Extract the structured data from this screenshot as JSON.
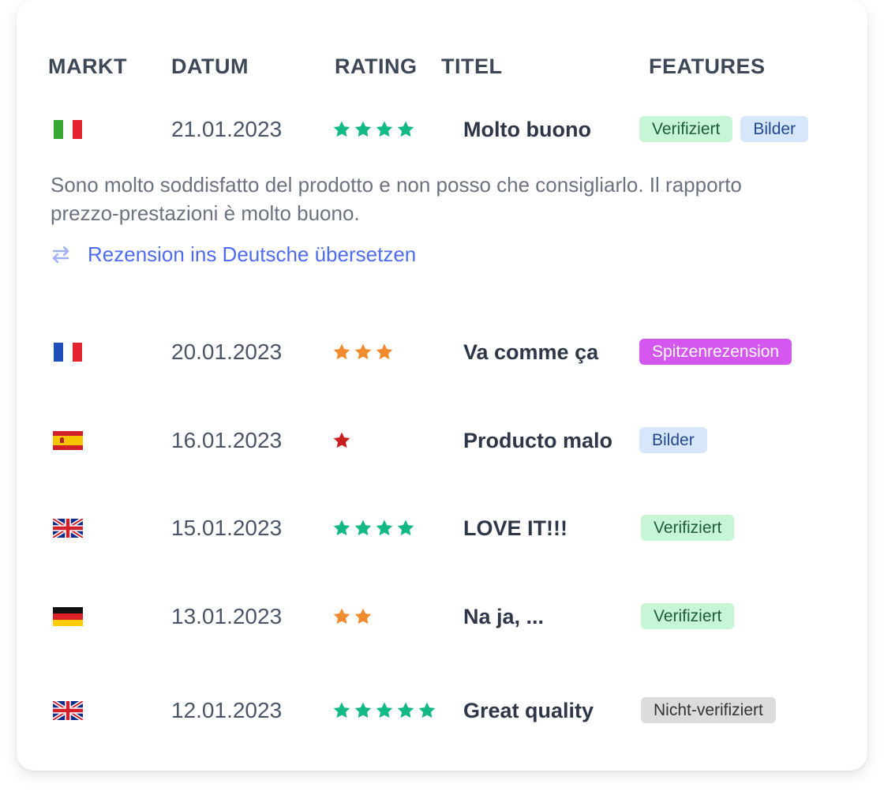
{
  "columns": {
    "market": "MARKT",
    "date": "DATUM",
    "rating": "RATING",
    "title": "TITEL",
    "features": "FEATURES"
  },
  "colors": {
    "star_green": "#12b886",
    "star_orange": "#f08c2e",
    "star_red": "#c81e1e",
    "link_blue": "#4e6cf2"
  },
  "reviews": [
    {
      "market_flag": "italy-flag",
      "date": "21.01.2023",
      "rating": 4,
      "rating_color": "green",
      "title": "Molto buono",
      "badges": [
        "Verifiziert",
        "Bilder"
      ],
      "text": "Sono molto soddisfatto del prodotto e non posso che consigliarlo. Il rapporto prezzo-prestazioni è molto buono.",
      "translate_label": "Rezension ins Deutsche übersetzen",
      "translate_icon": "swap-arrows-icon"
    },
    {
      "market_flag": "france-flag",
      "date": "20.01.2023",
      "rating": 3,
      "rating_color": "orange",
      "title": "Va comme ça",
      "badges": [
        "Spitzenrezension"
      ]
    },
    {
      "market_flag": "spain-flag",
      "date": "16.01.2023",
      "rating": 1,
      "rating_color": "red",
      "title": "Producto malo",
      "badges": [
        "Bilder"
      ]
    },
    {
      "market_flag": "uk-flag",
      "date": "15.01.2023",
      "rating": 4,
      "rating_color": "green",
      "title": "LOVE IT!!!",
      "badges": [
        "Verifiziert"
      ]
    },
    {
      "market_flag": "germany-flag",
      "date": "13.01.2023",
      "rating": 2,
      "rating_color": "orange",
      "title": "Na ja, ...",
      "badges": [
        "Verifiziert"
      ]
    },
    {
      "market_flag": "uk-flag",
      "date": "12.01.2023",
      "rating": 5,
      "rating_color": "green",
      "title": "Great quality",
      "badges": [
        "Nicht-verifiziert"
      ]
    }
  ]
}
